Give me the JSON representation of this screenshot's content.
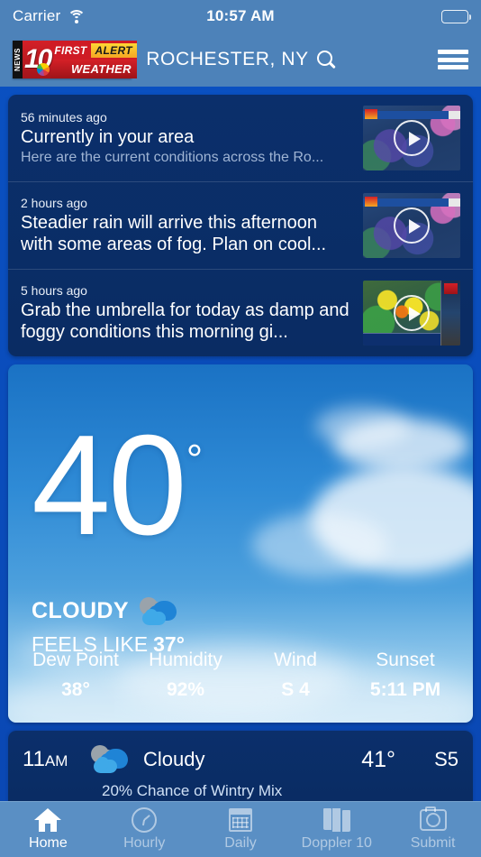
{
  "status_bar": {
    "carrier": "Carrier",
    "time": "10:57 AM",
    "wifi_icon": "wifi-icon",
    "battery_icon": "battery-icon"
  },
  "header": {
    "logo": {
      "news": "NEWS",
      "channel": "10",
      "first": "FIRST",
      "alert": "ALERT",
      "weather": "WEATHER"
    },
    "city": "ROCHESTER, NY",
    "search_icon": "search-icon",
    "menu_icon": "hamburger-menu-icon"
  },
  "news": [
    {
      "ago": "56 minutes ago",
      "title": "Currently in your area",
      "subtitle": "Here are the current conditions across the Ro...",
      "thumb_kind": "map",
      "play_icon": "play-icon"
    },
    {
      "ago": "2 hours ago",
      "title": "Steadier rain will arrive this afternoon with some areas of fog. Plan on cool...",
      "subtitle": "",
      "thumb_kind": "map",
      "play_icon": "play-icon"
    },
    {
      "ago": "5 hours ago",
      "title": "Grab the umbrella for today as damp and foggy conditions this morning gi...",
      "subtitle": "",
      "thumb_kind": "radar",
      "play_icon": "play-icon"
    }
  ],
  "current": {
    "temperature": "40",
    "degree": "°",
    "condition": "CLOUDY",
    "condition_icon": "cloudy-icon",
    "feels_like_label": "FEELS LIKE",
    "feels_like_value": "37°",
    "stats": [
      {
        "label": "Dew Point",
        "value": "38°"
      },
      {
        "label": "Humidity",
        "value": "92%"
      },
      {
        "label": "Wind",
        "value": "S 4"
      },
      {
        "label": "Sunset",
        "value": "5:11 PM"
      }
    ]
  },
  "hourly": {
    "time": "11",
    "period": "AM",
    "icon": "cloudy-icon",
    "condition": "Cloudy",
    "temp": "41°",
    "wind": "S5",
    "detail": "20% Chance of Wintry Mix"
  },
  "tabs": [
    {
      "label": "Home",
      "icon": "home-icon",
      "active": true
    },
    {
      "label": "Hourly",
      "icon": "clock-icon",
      "active": false
    },
    {
      "label": "Daily",
      "icon": "calendar-icon",
      "active": false
    },
    {
      "label": "Doppler 10",
      "icon": "map-icon",
      "active": false
    },
    {
      "label": "Submit",
      "icon": "camera-icon",
      "active": false
    }
  ],
  "colors": {
    "page_bg": "#0a4cbb",
    "chrome": "#4d82b9",
    "card_navy": "#0b2f6b",
    "tabbar": "#5a8fc4",
    "accent_red": "#d42027",
    "accent_yellow": "#f5a623"
  }
}
